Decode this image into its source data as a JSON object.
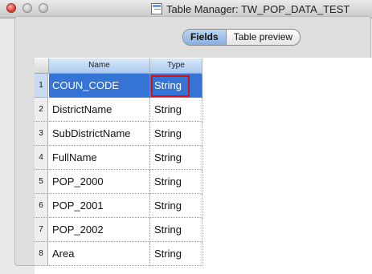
{
  "window": {
    "title": "Table Manager: TW_POP_DATA_TEST"
  },
  "tabs": [
    {
      "label": "Fields",
      "active": true
    },
    {
      "label": "Table preview",
      "active": false
    }
  ],
  "table": {
    "columns": [
      "Name",
      "Type"
    ],
    "rows": [
      {
        "num": "1",
        "name": "COUN_CODE",
        "type": "String",
        "selected": true
      },
      {
        "num": "2",
        "name": "DistrictName",
        "type": "String",
        "selected": false
      },
      {
        "num": "3",
        "name": "SubDistrictName",
        "type": "String",
        "selected": false
      },
      {
        "num": "4",
        "name": "FullName",
        "type": "String",
        "selected": false
      },
      {
        "num": "5",
        "name": "POP_2000",
        "type": "String",
        "selected": false
      },
      {
        "num": "6",
        "name": "POP_2001",
        "type": "String",
        "selected": false
      },
      {
        "num": "7",
        "name": "POP_2002",
        "type": "String",
        "selected": false
      },
      {
        "num": "8",
        "name": "Area",
        "type": "String",
        "selected": false
      }
    ]
  },
  "colors": {
    "selection": "#3574d4",
    "focus_outline": "#d0101c"
  }
}
